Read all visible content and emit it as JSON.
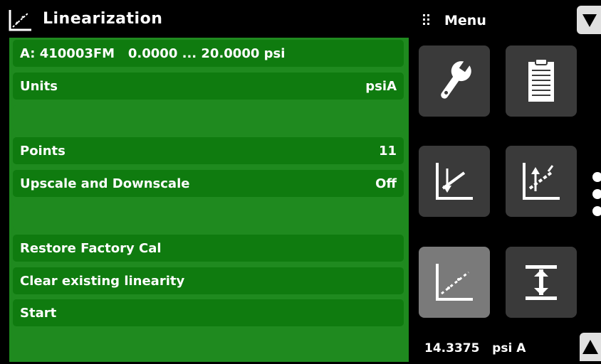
{
  "header": {
    "title": "Linearization",
    "menu_label": "Menu"
  },
  "list": {
    "rows": [
      {
        "label": "A: 410003FM   0.0000 ... 20.0000 psi",
        "value": ""
      },
      {
        "label": "Units",
        "value": "psiA"
      },
      {
        "label": "",
        "value": ""
      },
      {
        "label": "Points",
        "value": "11"
      },
      {
        "label": "Upscale and Downscale",
        "value": "Off"
      },
      {
        "label": "",
        "value": ""
      },
      {
        "label": "Restore Factory Cal",
        "value": ""
      },
      {
        "label": "Clear existing linearity",
        "value": ""
      },
      {
        "label": "Start",
        "value": ""
      }
    ]
  },
  "status": {
    "reading": "14.3375   psi A"
  },
  "icons": {
    "b1": "wrench-icon",
    "b2": "clipboard-icon",
    "b3": "calibration-down-icon",
    "b4": "calibration-up-icon",
    "b5": "linearization-icon",
    "b6": "span-adjust-icon"
  },
  "colors": {
    "list_bg": "#1f8a1f",
    "row_bg": "#0f7b0f",
    "button_bg": "#3a3a3a",
    "button_active": "#7a7a7a"
  }
}
